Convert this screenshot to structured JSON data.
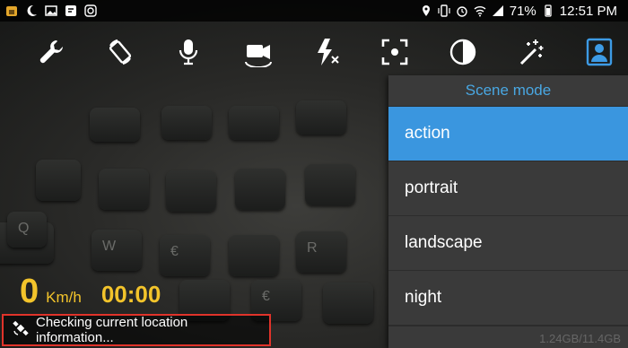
{
  "status_bar": {
    "left_icons": [
      "app-home-icon",
      "moon-icon",
      "image-icon",
      "message-icon",
      "instagram-icon"
    ],
    "right_icons": [
      "location-icon",
      "vibrate-icon",
      "alarm-icon",
      "wifi-icon",
      "signal-icon",
      "battery-icon"
    ],
    "battery_text": "71%",
    "time": "12:51 PM"
  },
  "toolbar": {
    "items": [
      {
        "icon": "wrench-icon",
        "name": "settings"
      },
      {
        "icon": "rotate-icon",
        "name": "rotate"
      },
      {
        "icon": "microphone-icon",
        "name": "audio"
      },
      {
        "icon": "video-camera-icon",
        "name": "camera-switch"
      },
      {
        "icon": "flash-off-icon",
        "name": "flash"
      },
      {
        "icon": "focus-icon",
        "name": "focus"
      },
      {
        "icon": "exposure-icon",
        "name": "exposure"
      },
      {
        "icon": "magic-wand-icon",
        "name": "effects"
      },
      {
        "icon": "portrait-icon",
        "name": "scene-mode"
      }
    ]
  },
  "scene_menu": {
    "title": "Scene mode",
    "items": [
      "action",
      "portrait",
      "landscape",
      "night"
    ],
    "selected": "action"
  },
  "storage_text": "1.24GB/11.4GB",
  "speed": {
    "value": "0",
    "unit": "Km/h",
    "timer": "00:00"
  },
  "location": {
    "message": "Checking current location information..."
  },
  "colors": {
    "accent_blue": "#3a96df",
    "title_blue": "#49a7e2",
    "speed_yellow": "#f3c42b",
    "highlight_red": "#e0332a"
  }
}
